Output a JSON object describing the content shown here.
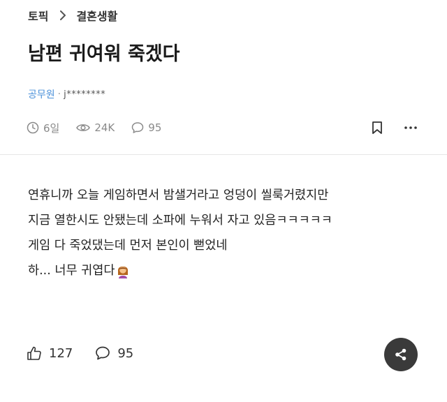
{
  "breadcrumb": {
    "root": "토픽",
    "current": "결혼생활"
  },
  "post": {
    "title": "남편 귀여워 죽겠다",
    "author_job": "공무원",
    "author_separator": "·",
    "author_id": "j********",
    "time": "6일",
    "views": "24K",
    "comments": "95",
    "body_lines": [
      "연휴니까 오늘 게임하면서 밤샐거라고 엉덩이 씰룩거렸지만",
      "지금 열한시도 안됐는데 소파에 누워서 자고 있음ㅋㅋㅋㅋㅋ",
      "게임 다 죽었댔는데 먼저 본인이 뻗었네",
      "하... 너무 귀엽다"
    ]
  },
  "reactions": {
    "likes": "127",
    "comments": "95"
  },
  "icons": {
    "breadcrumb_chevron": "chevron-right-icon",
    "time": "clock-icon",
    "views": "eye-icon",
    "comments": "comment-icon",
    "bookmark": "bookmark-icon",
    "more": "more-icon",
    "like": "thumbs-up-icon",
    "share": "share-icon",
    "body_emoji": "woman-emoji-icon"
  },
  "colors": {
    "accent": "#4a90d9",
    "muted": "#8a8a8a",
    "share_button_bg": "#3a3a3a"
  }
}
